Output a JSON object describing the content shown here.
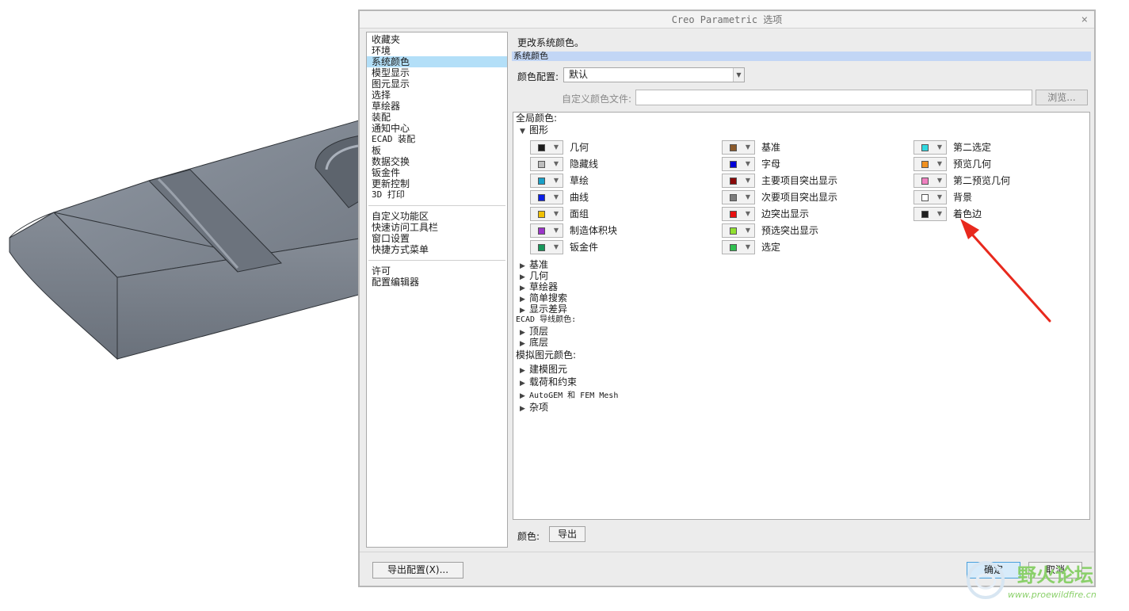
{
  "dialog": {
    "title": "Creo Parametric 选项",
    "close_glyph": "×"
  },
  "nav": {
    "group1": [
      "收藏夹",
      "环境",
      "系统颜色",
      "模型显示",
      "图元显示",
      "选择",
      "草绘器",
      "装配",
      "通知中心",
      "ECAD 装配",
      "板",
      "数据交换",
      "钣金件",
      "更新控制",
      "3D 打印"
    ],
    "group2": [
      "自定义功能区",
      "快速访问工具栏",
      "窗口设置",
      "快捷方式菜单"
    ],
    "group3": [
      "许可",
      "配置编辑器"
    ],
    "selected": "系统颜色"
  },
  "main": {
    "description": "更改系统颜色。",
    "section_title": "系统颜色",
    "scheme_label": "颜色配置:",
    "scheme_value": "默认",
    "custom_file_label": "自定义颜色文件:",
    "custom_file_value": "",
    "browse_label": "浏览...",
    "global_colors_label": "全局颜色:",
    "graphics_label": "图形",
    "graphics_colors": [
      {
        "label": "几何",
        "color": "#1c1c1c"
      },
      {
        "label": "隐藏线",
        "color": "#bdbdbd"
      },
      {
        "label": "草绘",
        "color": "#1aa0c8"
      },
      {
        "label": "曲线",
        "color": "#0a1ee6"
      },
      {
        "label": "面组",
        "color": "#f0c000"
      },
      {
        "label": "制造体积块",
        "color": "#9b35c9"
      },
      {
        "label": "钣金件",
        "color": "#16965a"
      },
      {
        "label": "基准",
        "color": "#8b5a2b"
      },
      {
        "label": "字母",
        "color": "#0000d8"
      },
      {
        "label": "主要项目突出显示",
        "color": "#8a0a0a"
      },
      {
        "label": "次要项目突出显示",
        "color": "#7c7c7c"
      },
      {
        "label": "边突出显示",
        "color": "#e81010"
      },
      {
        "label": "预选突出显示",
        "color": "#90e030"
      },
      {
        "label": "选定",
        "color": "#30c050"
      },
      {
        "label": "第二选定",
        "color": "#30d8e0"
      },
      {
        "label": "预览几何",
        "color": "#f09020"
      },
      {
        "label": "第二预览几何",
        "color": "#f080c0"
      },
      {
        "label": "背景",
        "color": "#ffffff"
      },
      {
        "label": "着色边",
        "color": "#202020"
      }
    ],
    "global_groups": [
      "基准",
      "几何",
      "草绘器",
      "简单搜索",
      "显示差异"
    ],
    "ecad_label": "ECAD 导线颜色:",
    "ecad_groups": [
      "顶层",
      "底层"
    ],
    "sim_label": "模拟图元颜色:",
    "sim_groups": [
      "建模图元",
      "载荷和约束",
      "AutoGEM 和 FEM Mesh",
      "杂项"
    ],
    "color_label": "颜色:",
    "export_label": "导出"
  },
  "footer": {
    "export_config": "导出配置(X)...",
    "ok": "确定",
    "cancel": "取消"
  },
  "watermark": {
    "title": "野火论坛",
    "url": "www.proewildfire.cn"
  },
  "colors": {
    "selection": "#b3dff8",
    "section_header": "#c2d6f5",
    "annotation_arrow": "#e8291d",
    "model_gray": "#7f8690"
  }
}
